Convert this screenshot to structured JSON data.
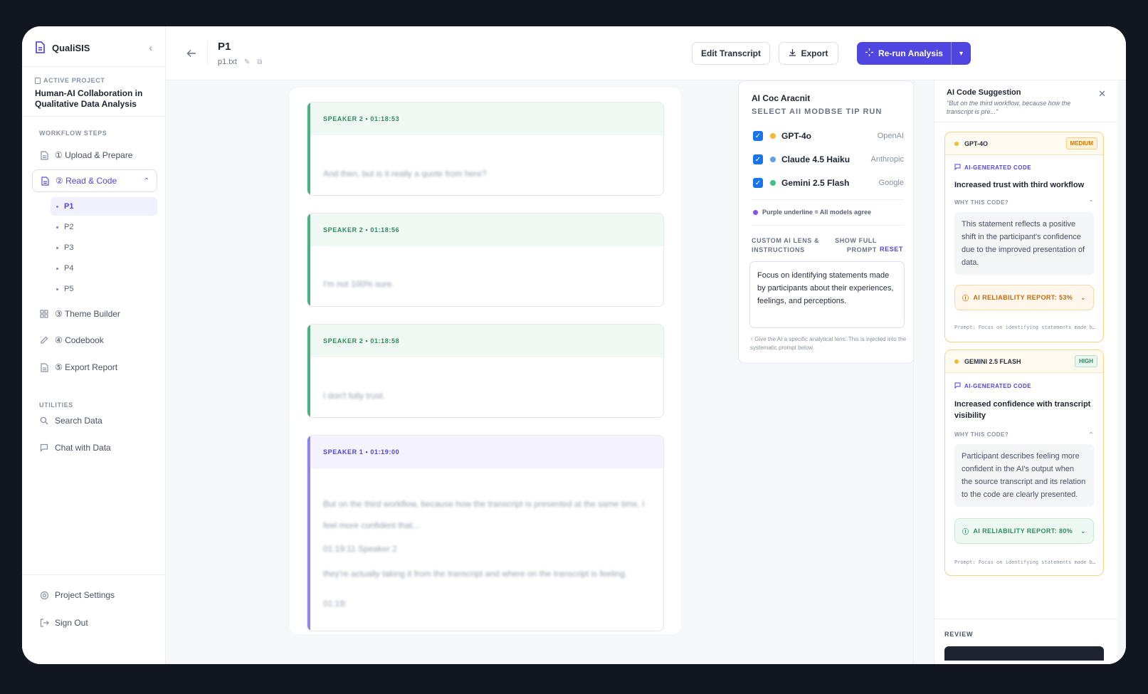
{
  "app": {
    "name": "QualiSIS"
  },
  "active_project": {
    "label": "ACTIVE PROJECT",
    "title": "Human-AI Collaboration in Qualitative Data Analysis"
  },
  "workflow": {
    "label": "WORKFLOW STEPS",
    "steps": [
      {
        "label": "① Upload & Prepare"
      },
      {
        "label": "② Read & Code"
      },
      {
        "label": "③ Theme Builder"
      },
      {
        "label": "④ Codebook"
      },
      {
        "label": "⑤ Export Report"
      }
    ],
    "participants": [
      "P1",
      "P2",
      "P3",
      "P4",
      "P5"
    ]
  },
  "utilities": {
    "label": "UTILITIES",
    "items": [
      {
        "label": "Search Data"
      },
      {
        "label": "Chat with Data"
      }
    ]
  },
  "footer": {
    "settings": "Project Settings",
    "signout": "Sign Out"
  },
  "header": {
    "title": "P1",
    "file": "p1.txt",
    "edit_transcript": "Edit Transcript",
    "export": "Export",
    "rerun": "Re-run Analysis"
  },
  "transcript": {
    "segments": [
      {
        "head": "SPEAKER 2 • 01:18:53",
        "text": "And then, but is it really a quote from here?"
      },
      {
        "head": "SPEAKER 2 • 01:18:56",
        "text": "I'm not 100% sure."
      },
      {
        "head": "SPEAKER 2 • 01:18:58",
        "text": "I don't fully trust."
      },
      {
        "head": "SPEAKER 1 • 01:19:00",
        "lines": [
          "But on the third workflow, because how the transcript is presented at the same time, I",
          "feel more confident that...",
          "01:19:11 Speaker 2",
          "they're actually taking it from the transcript and where on the transcript is feeling.",
          "01:19:"
        ]
      }
    ]
  },
  "model_panel": {
    "title": "AI Coc Aracnit",
    "subtitle": "SELECT AII  MODBSE TIP RUN",
    "models": [
      {
        "name": "GPT-4o",
        "vendor": "OpenAI",
        "color": "#f5b82e"
      },
      {
        "name": "Claude 4.5 Haiku",
        "vendor": "Anthropic",
        "color": "#5fa0e8"
      },
      {
        "name": "Gemini 2.5 Flash",
        "vendor": "Google",
        "color": "#3fbf8a"
      }
    ],
    "legend": "Purple underline = All models agree",
    "lens_label": "CUSTOM AI LENS & INSTRUCTIONS",
    "show_full": "SHOW FULL PROMPT",
    "reset": "RESET",
    "lens_text": "Focus on identifying statements made by participants about their experiences, feelings, and perceptions.",
    "lens_help": "↑ Give the AI a specific analytical lens. This is injected into the systematic prompt below."
  },
  "suggestion": {
    "title": "AI Code Suggestion",
    "quote": "\"But on the third workflow, because how the transcript is pre...\"",
    "cards": [
      {
        "model": "GPT-4O",
        "badge": "MEDIUM",
        "ai_label": "AI-GENERATED CODE",
        "code": "Increased trust with third workflow",
        "why": "WHY THIS CODE?",
        "explanation": "This statement reflects a positive shift in the participant's confidence due to the improved presentation of data.",
        "reliability": "AI RELIABILITY REPORT: 53%",
        "prompt": "Prompt: Focus on identifying statements made by participants"
      },
      {
        "model": "GEMINI 2.5 FLASH",
        "badge": "HIGH",
        "ai_label": "AI-GENERATED CODE",
        "code": "Increased confidence with transcript visibility",
        "why": "WHY THIS CODE?",
        "explanation": "Participant describes feeling more confident in the AI's output when the source transcript and its relation to the code are clearly presented.",
        "reliability": "AI RELIABILITY REPORT: 80%",
        "prompt": "Prompt: Focus on identifying statements made by participants"
      }
    ],
    "review": "REVIEW"
  }
}
